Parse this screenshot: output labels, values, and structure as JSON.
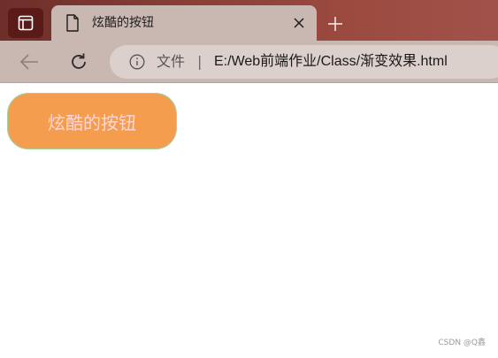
{
  "browser": {
    "tab": {
      "title": "炫酷的按钮",
      "close_label": "×"
    },
    "new_tab_label": "+",
    "address": {
      "chip": "文件",
      "separator": "|",
      "url": "E:/Web前端作业/Class/渐变效果.html"
    }
  },
  "page": {
    "button_label": "炫酷的按钮"
  },
  "watermark": "CSDN @Q鑫",
  "colors": {
    "tabstrip": "#8a3f37",
    "toolbar": "#c9b7b2",
    "button_bg": "#f59d4e",
    "button_text": "#ffd6d6",
    "button_border": "#9fd3a0"
  }
}
